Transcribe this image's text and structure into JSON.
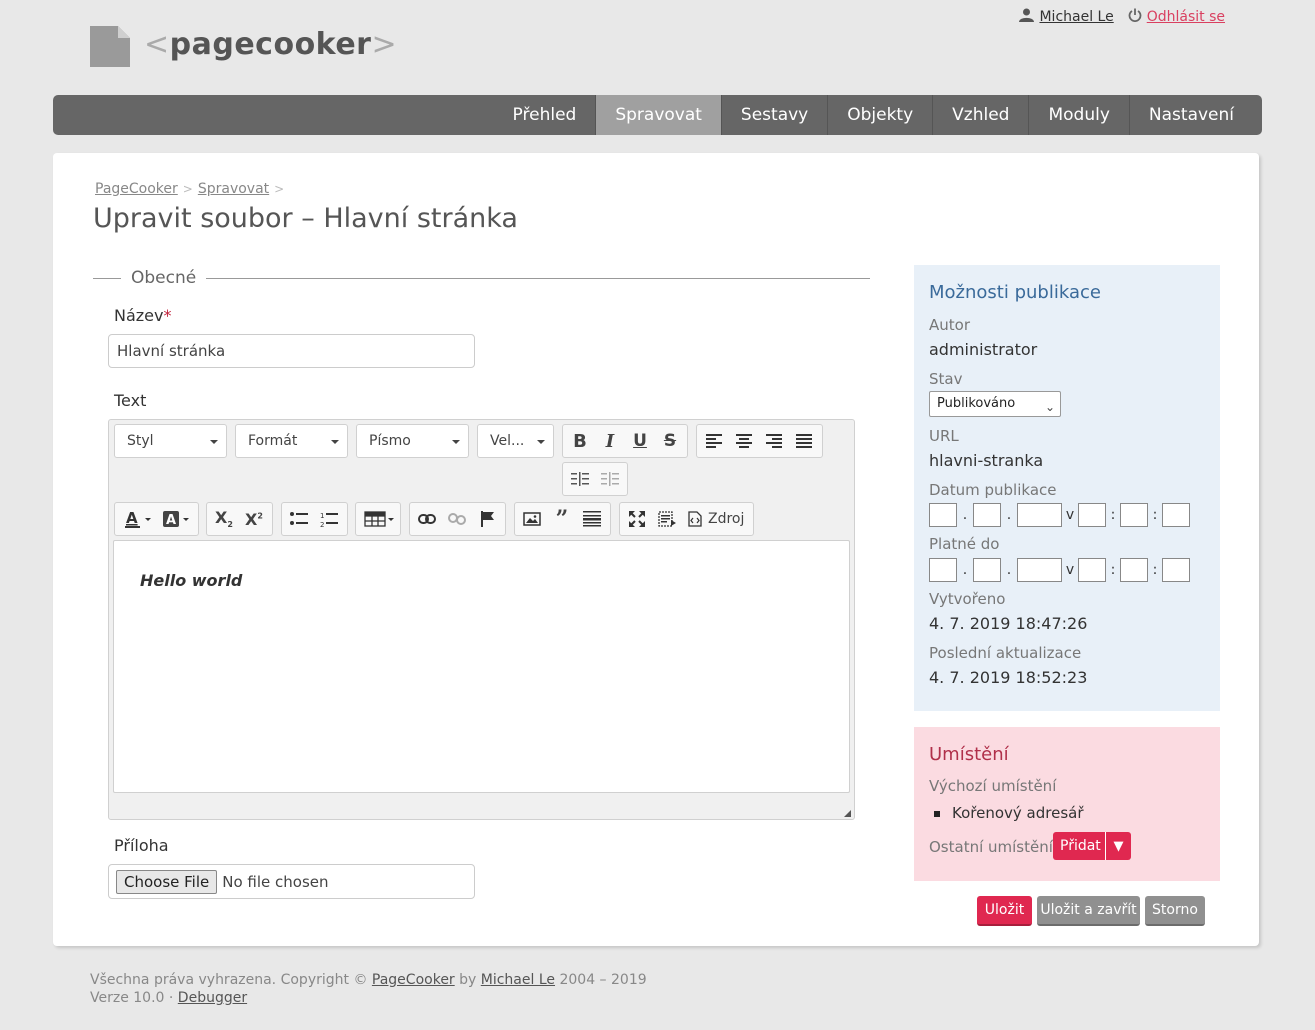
{
  "header": {
    "logo_name": "pagecooker",
    "user_name": "Michael Le",
    "logout_label": "Odhlásit se"
  },
  "nav": {
    "items": [
      "Přehled",
      "Spravovat",
      "Sestavy",
      "Objekty",
      "Vzhled",
      "Moduly",
      "Nastavení"
    ],
    "active": "Spravovat"
  },
  "breadcrumb": [
    "PageCooker",
    "Spravovat"
  ],
  "page_title": "Upravit soubor – Hlavní stránka",
  "form": {
    "section_legend": "Obecné",
    "name_label": "Název",
    "name_required_mark": "*",
    "name_value": "Hlavní stránka",
    "text_label": "Text",
    "attachment_label": "Příloha",
    "file_button": "Choose File",
    "file_status": "No file chosen"
  },
  "editor": {
    "combos": {
      "style": "Styl",
      "format": "Formát",
      "font": "Písmo",
      "size": "Vel..."
    },
    "source_label": "Zdroj",
    "content": "Hello world",
    "icons": [
      "bold-icon",
      "italic-icon",
      "underline-icon",
      "strikethrough-icon",
      "align-left-icon",
      "align-center-icon",
      "align-right-icon",
      "align-justify-icon",
      "indent-icon",
      "outdent-icon",
      "text-color-icon",
      "background-color-icon",
      "subscript-icon",
      "superscript-icon",
      "bulleted-list-icon",
      "numbered-list-icon",
      "table-icon",
      "link-icon",
      "unlink-icon",
      "anchor-flag-icon",
      "image-icon",
      "blockquote-icon",
      "horizontal-rule-icon",
      "maximize-icon",
      "show-blocks-icon",
      "source-icon"
    ]
  },
  "publish": {
    "title": "Možnosti publikace",
    "author_label": "Autor",
    "author_value": "administrator",
    "status_label": "Stav",
    "status_value": "Publikováno",
    "url_label": "URL",
    "url_value": "hlavni-stranka",
    "publish_date_label": "Datum publikace",
    "valid_until_label": "Platné do",
    "date_separator": ".",
    "time_separator": ":",
    "at_label": "v",
    "created_label": "Vytvořeno",
    "created_value": "4. 7. 2019 18:47:26",
    "updated_label": "Poslední aktualizace",
    "updated_value": "4. 7. 2019 18:52:23"
  },
  "location": {
    "title": "Umístění",
    "default_label": "Výchozí umístění",
    "default_item": "Kořenový adresář",
    "other_label": "Ostatní umístění",
    "add_label": "Přidat"
  },
  "actions": {
    "save": "Uložit",
    "save_close": "Uložit a zavřít",
    "cancel": "Storno"
  },
  "footer": {
    "rights_prefix": "Všechna práva vyhrazena. Copyright ©",
    "product_link": "PageCooker",
    "by": "by",
    "author_link": "Michael Le",
    "years": "2004 – 2019",
    "version": "Verze 10.0 ·",
    "debugger_link": "Debugger"
  },
  "colors": {
    "nav_bg": "#666666",
    "nav_active": "#a0a0a0",
    "accent_red": "#e02850",
    "publish_panel": "#e8f0f8",
    "location_panel": "#fbdbe1"
  }
}
